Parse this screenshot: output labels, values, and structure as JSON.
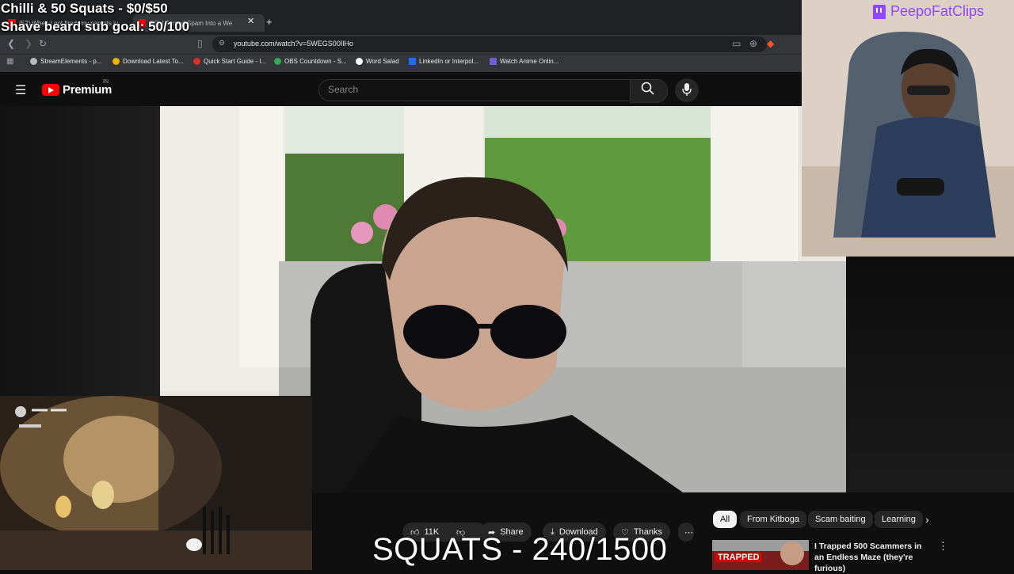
{
  "overlay": {
    "goal_line_1": "Chilli & 50 Squats - $0/$50",
    "goal_line_2": "Shave beard sub goal: 50/100",
    "counter": "SQUATS - 240/1500",
    "channel": "PeepoFatClips"
  },
  "browser": {
    "tabs": [
      {
        "label": "(52) When I got fired, my parents ju"
      },
      {
        "label": "(52) I Turned Spam Into a We"
      }
    ],
    "url": "youtube.com/watch?v=5WEGS00IlHo",
    "bookmarks": [
      {
        "label": "StreamElements - p..."
      },
      {
        "label": "Download Latest To..."
      },
      {
        "label": "Quick Start Guide - I..."
      },
      {
        "label": "OBS Countdown - S..."
      },
      {
        "label": "Word Salad"
      },
      {
        "label": "LinkedIn or Interpol..."
      },
      {
        "label": "Watch Anime Onlin..."
      }
    ]
  },
  "youtube": {
    "brand": "Premium",
    "region": "IN",
    "search_placeholder": "Search",
    "actions": {
      "like_count": "11K",
      "share": "Share",
      "download": "Download",
      "thanks": "Thanks"
    },
    "chips": [
      "All",
      "From Kitboga",
      "Scam baiting",
      "Learning"
    ],
    "recommendation": {
      "title": "I Trapped 500 Scammers in an Endless Maze (they're furious)",
      "thumb_text": "TRAPPED"
    }
  },
  "colors": {
    "yt_red": "#ff0000",
    "twitch_purple": "#9146ff",
    "page_bg": "#0f0f0f"
  }
}
